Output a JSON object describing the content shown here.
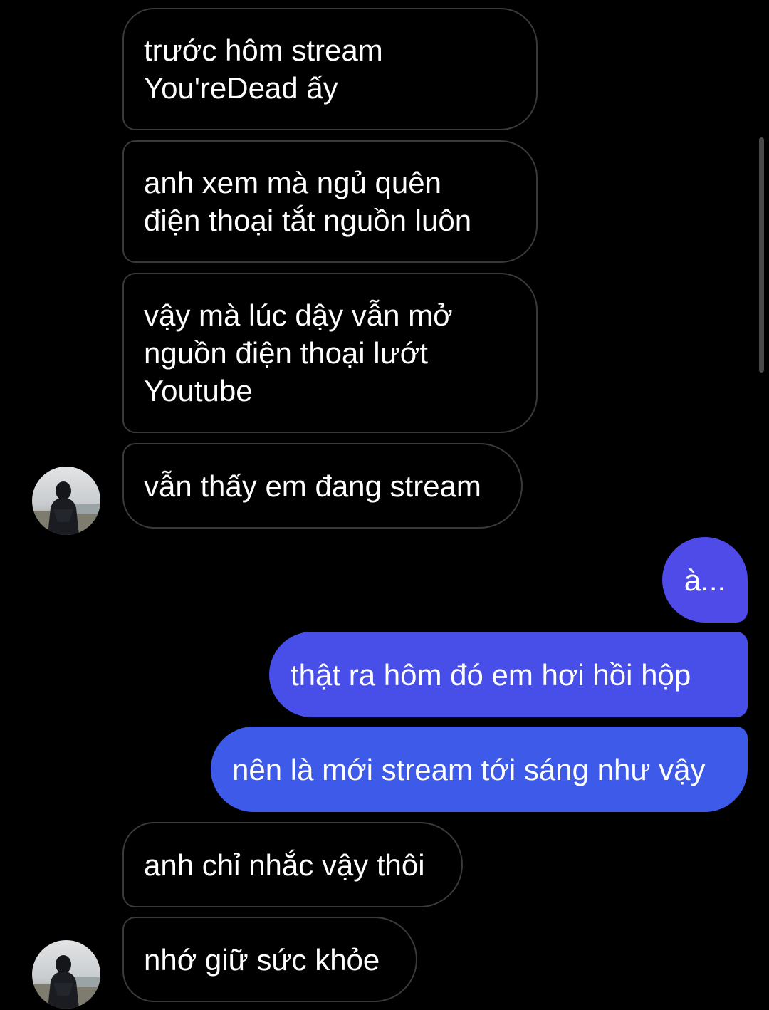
{
  "messages": {
    "m1": {
      "lines": [
        "trước hôm stream",
        "You'reDead ấy"
      ]
    },
    "m2": {
      "lines": [
        "anh xem mà ngủ quên",
        "điện thoại tắt nguồn luôn"
      ]
    },
    "m3": {
      "lines": [
        "vậy mà lúc dậy vẫn mở",
        "nguồn điện thoại lướt",
        "Youtube"
      ]
    },
    "m4": {
      "text": "vẫn thấy em đang stream"
    },
    "m5": {
      "text": "à..."
    },
    "m6": {
      "text": "thật ra hôm đó em hơi hồi hộp"
    },
    "m7": {
      "text": "nên là mới stream tới sáng như vậy"
    },
    "m8": {
      "text": "anh chỉ nhắc vậy thôi"
    },
    "m9": {
      "text": "nhớ giữ sức khỏe"
    }
  },
  "colors": {
    "background": "#000000",
    "received_border": "#3a3a3c",
    "sent_top": "#4f4be8",
    "sent_bottom": "#3c5be8"
  },
  "icons": {
    "avatar": "contact-avatar-photo"
  }
}
